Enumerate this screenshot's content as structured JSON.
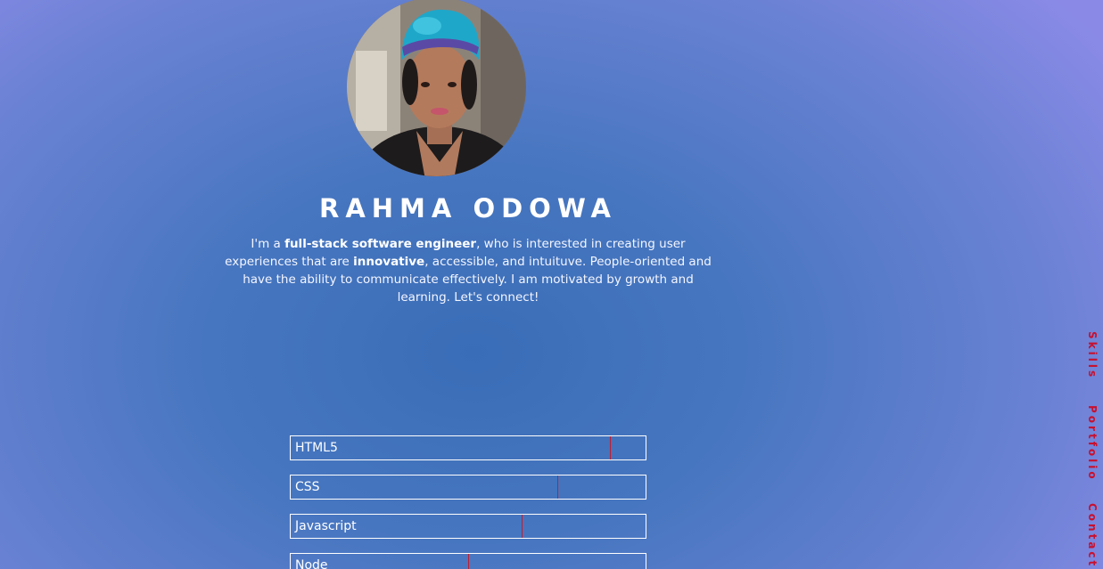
{
  "profile": {
    "name": "RAHMA ODOWA",
    "avatar_icon": "profile-photo",
    "bio": {
      "p1": "I'm a ",
      "b1": "full-stack software engineer",
      "p2": ", who is interested in creating user experiences that are ",
      "b2": "innovative",
      "p3": ", accessible, and intuituve. People-oriented and have the ability to communicate effectively. I am motivated by growth and learning. Let's connect!"
    }
  },
  "skills": [
    {
      "label": "HTML5",
      "level": 0.9
    },
    {
      "label": "CSS",
      "level": 0.75
    },
    {
      "label": "Javascript",
      "level": 0.65
    },
    {
      "label": "Node",
      "level": 0.5
    }
  ],
  "nav": {
    "skills": "Skills",
    "portfolio": "Portfolio",
    "contact": "Contact"
  },
  "colors": {
    "accent": "#c8102e",
    "background": "#4776c0"
  }
}
